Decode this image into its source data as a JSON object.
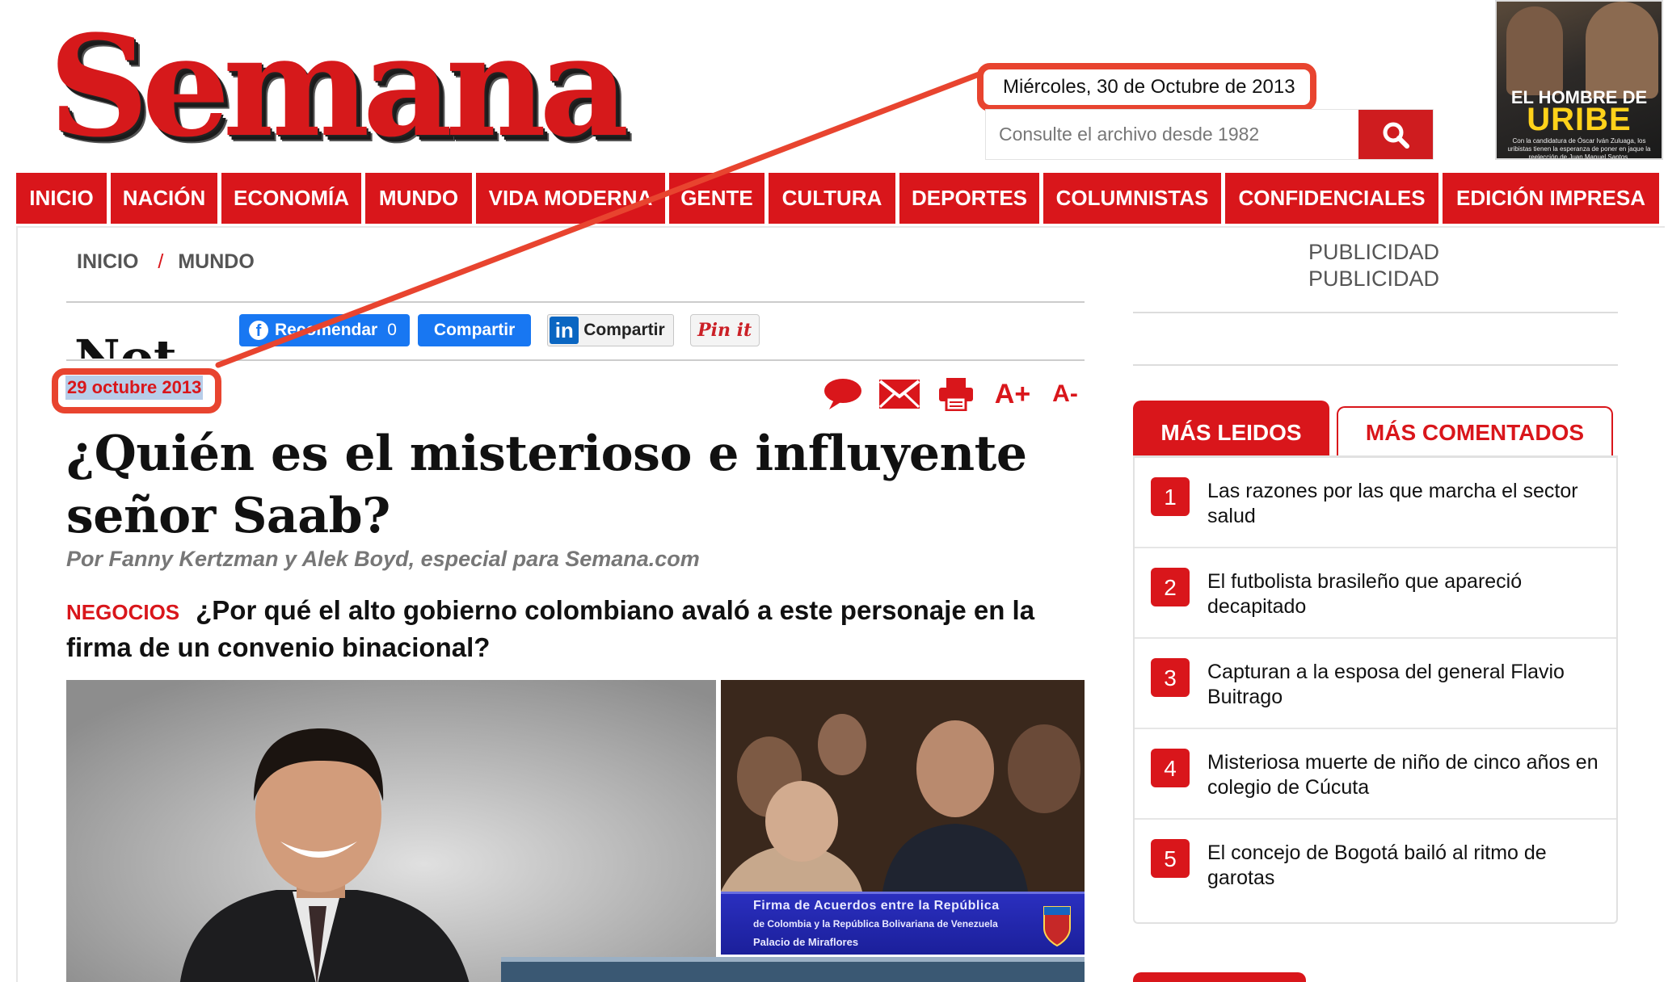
{
  "header": {
    "logo_text": "Semana",
    "date": "Miércoles, 30 de Octubre de 2013",
    "search_placeholder": "Consulte el archivo desde 1982",
    "cover": {
      "title_line1": "EL HOMBRE DE",
      "title_line2": "URIBE",
      "subtitle": "Con la candidatura de Óscar Iván Zuluaga, los uribistas tienen la esperanza de poner en jaque la reelección de Juan Manuel Santos."
    }
  },
  "nav": {
    "items": [
      {
        "label": "INICIO",
        "w": 112
      },
      {
        "label": "NACIÓN",
        "w": 132
      },
      {
        "label": "ECONOMÍA",
        "w": 173
      },
      {
        "label": "MUNDO",
        "w": 132
      },
      {
        "label": "VIDA MODERNA",
        "w": 234
      },
      {
        "label": "GENTE",
        "w": 118
      },
      {
        "label": "CULTURA",
        "w": 157
      },
      {
        "label": "DEPORTES",
        "w": 173
      },
      {
        "label": "COLUMNISTAS",
        "w": 220
      },
      {
        "label": "CONFIDENCIALES",
        "w": 264
      },
      {
        "label": "EDICIÓN IMPRESA",
        "w": 268
      }
    ]
  },
  "breadcrumb": {
    "home": "INICIO",
    "separator": "/",
    "section": "MUNDO"
  },
  "article": {
    "section_heading_partial": "Not",
    "social": {
      "recommend": "Recomendar",
      "recommend_count": "0",
      "share": "Compartir",
      "linkedin_share": "Compartir",
      "linkedin_logo": "in",
      "pinterest": "Pin it"
    },
    "date": "29 octubre 2013",
    "tools": {
      "font_increase": "A+",
      "font_decrease": "A-"
    },
    "headline": "¿Quién es el misterioso e influyente señor Saab?",
    "byline": "Por Fanny Kertzman y Alek Boyd, especial para Semana.com",
    "tag": "NEGOCIOS",
    "lede": "¿Por qué el alto gobierno colombiano avaló a este personaje en la firma de un convenio binacional?",
    "photo_caption": {
      "line1": "Firma de Acuerdos entre la República",
      "line2": "de Colombia y la República Bolivariana de Venezuela",
      "line3": "Palacio de Miraflores"
    }
  },
  "sidebar": {
    "advertising": [
      "PUBLICIDAD",
      "PUBLICIDAD"
    ],
    "tabs": {
      "most_read": "MÁS LEIDOS",
      "most_commented": "MÁS COMENTADOS"
    },
    "most_read": [
      {
        "rank": "1",
        "title": "Las razones por las que marcha el sector salud"
      },
      {
        "rank": "2",
        "title": "El futbolista brasileño que apareció decapitado"
      },
      {
        "rank": "3",
        "title": "Capturan a la esposa del general Flavio Buitrago"
      },
      {
        "rank": "4",
        "title": "Misteriosa muerte de niño de cinco años en colegio de Cúcuta"
      },
      {
        "rank": "5",
        "title": "El concejo de Bogotá bailó al ritmo de garotas"
      }
    ]
  },
  "colors": {
    "brand_red": "#d9161b",
    "annotation_red": "#e8442f",
    "facebook_blue": "#1877f2",
    "linkedin_blue": "#0a66c2"
  }
}
